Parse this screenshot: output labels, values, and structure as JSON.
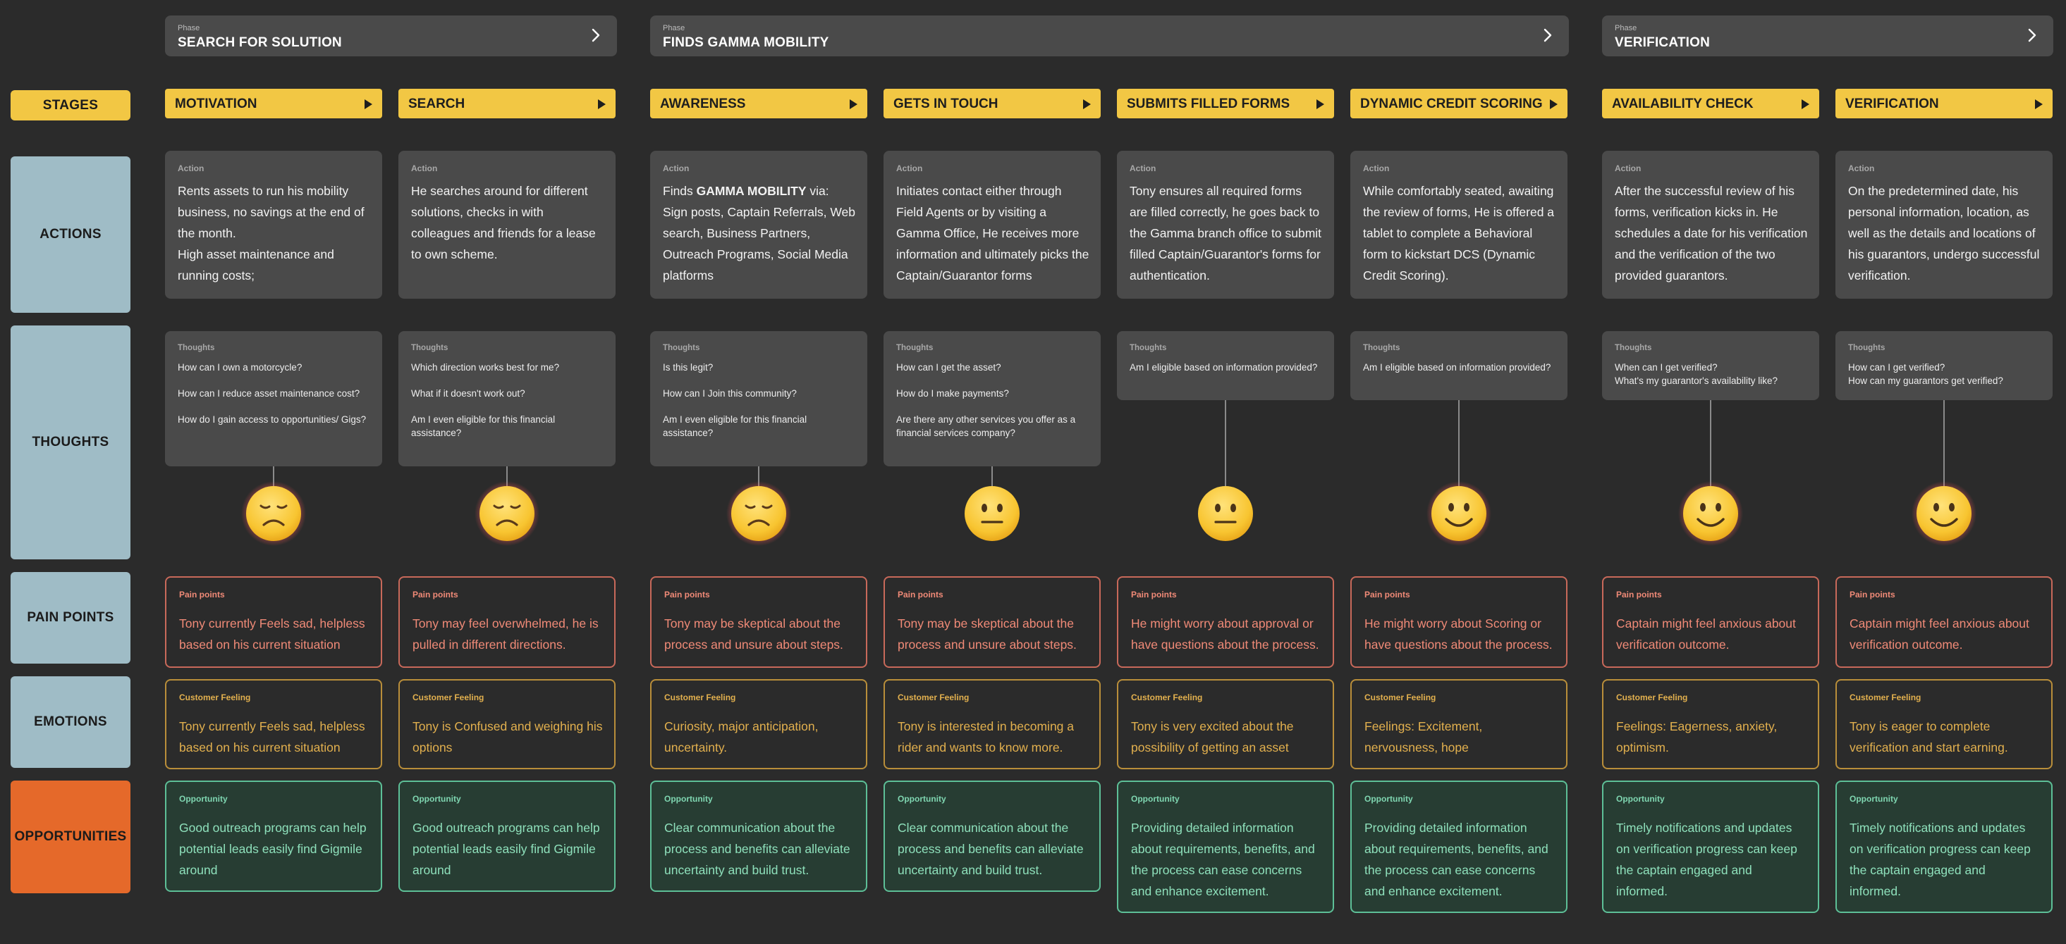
{
  "phases": [
    {
      "label": "Phase",
      "title": "SEARCH  FOR SOLUTION"
    },
    {
      "label": "Phase",
      "title": "FINDS GAMMA MOBILITY"
    },
    {
      "label": "Phase",
      "title": "VERIFICATION"
    }
  ],
  "row_headers": {
    "stages": "STAGES",
    "actions": "ACTIONS",
    "thoughts": "THOUGHTS",
    "pain_points": "PAIN POINTS",
    "emotions": "EMOTIONS",
    "opportunities": "OPPORTUNITIES"
  },
  "card_titles": {
    "action": "Action",
    "thoughts": "Thoughts",
    "pain": "Pain points",
    "feeling": "Customer Feeling",
    "opportunity": "Opportunity"
  },
  "stages": [
    {
      "name": "MOTIVATION",
      "action": "Rents assets to run his mobility business, no savings at the end of the month.\nHigh asset maintenance and running costs;",
      "thoughts": "How can I own a motorcycle?\n\nHow can I reduce asset maintenance cost?\n\nHow do I gain access to opportunities/ Gigs?",
      "emotion": "sad",
      "pain": "Tony currently Feels sad, helpless based on his current situation",
      "feeling": "Tony currently Feels sad, helpless based on his current situation",
      "opportunity": "Good outreach programs can help potential leads easily find Gigmile around"
    },
    {
      "name": "SEARCH",
      "action": "He searches around for different solutions, checks in with colleagues and friends for a lease to own scheme.",
      "thoughts": "Which direction works best for me?\n\nWhat if it doesn't work out?\n\nAm I even eligible for this financial assistance?",
      "emotion": "sad",
      "pain": "Tony may feel overwhelmed, he is pulled in different directions.",
      "feeling": "Tony is Confused and weighing his options",
      "opportunity": "Good outreach programs can help potential leads easily find Gigmile around"
    },
    {
      "name": "AWARENESS",
      "action_prefix": "Finds ",
      "action_bold": "GAMMA MOBILITY",
      "action": " via:\nSign posts, Captain Referrals, Web search, Business Partners, Outreach Programs, Social Media platforms",
      "thoughts": "Is this legit?\n\nHow can I Join this community?\n\nAm I even eligible for this financial assistance?",
      "emotion": "sad",
      "pain": "Tony may be skeptical about the process and unsure about steps.",
      "feeling": "Curiosity, major anticipation, uncertainty.",
      "opportunity": "Clear communication about the process and benefits can alleviate uncertainty and build trust."
    },
    {
      "name": "GETS IN TOUCH",
      "action": "Initiates contact either through Field Agents or by visiting a Gamma Office, He receives more information and ultimately picks the Captain/Guarantor forms",
      "thoughts": "How can I get the asset?\n\nHow do I make payments?\n\nAre there any other services you offer as a financial services company?",
      "emotion": "neutral",
      "pain": "Tony may be skeptical about the process and unsure about steps.",
      "feeling": "Tony is interested in becoming a rider and wants to know more.",
      "opportunity": "Clear communication about the process and benefits can alleviate uncertainty and build trust."
    },
    {
      "name": "SUBMITS FILLED FORMS",
      "action": "Tony ensures all required forms are filled correctly, he goes back to the Gamma branch office to submit filled Captain/Guarantor's forms for authentication.",
      "thoughts": "Am I eligible based on information provided?",
      "emotion": "neutral",
      "pain": "He might worry about approval or have questions about the process.",
      "feeling": "Tony is very excited about the possibility of getting an asset",
      "opportunity": "Providing detailed information about requirements, benefits, and the  process can ease concerns and enhance excitement."
    },
    {
      "name": "DYNAMIC CREDIT SCORING",
      "action": "While comfortably seated, awaiting the review of forms, He is offered a tablet to complete a Behavioral form to kickstart DCS (Dynamic Credit Scoring).",
      "thoughts": "Am I eligible based on information provided?",
      "emotion": "happy",
      "pain": "He might worry about Scoring or have questions about the process.",
      "feeling": "Feelings: Excitement, nervousness, hope",
      "opportunity": "Providing detailed information about requirements, benefits, and the  process can ease concerns and enhance excitement."
    },
    {
      "name": "AVAILABILITY CHECK",
      "action": "After the successful review of his forms, verification kicks in. He schedules a date for his verification and the verification of the two provided guarantors.",
      "thoughts": "When can I get verified?\nWhat's my guarantor's availability like?",
      "emotion": "happy",
      "pain": "Captain might feel anxious about verification outcome.",
      "feeling": "Feelings: Eagerness, anxiety, optimism.",
      "opportunity": "Timely notifications and updates on verification progress can keep the captain engaged and informed."
    },
    {
      "name": "VERIFICATION",
      "action": "On the predetermined date, his personal information, location, as well as the details and locations of his guarantors, undergo successful verification.",
      "thoughts": "How can I get verified?\nHow can my guarantors get verified?",
      "emotion": "happy",
      "pain": "Captain might feel anxious about verification outcome.",
      "feeling": "Tony is eager to complete verification and start earning.",
      "opportunity": "Timely notifications and updates on verification progress can keep the captain engaged and informed."
    }
  ]
}
